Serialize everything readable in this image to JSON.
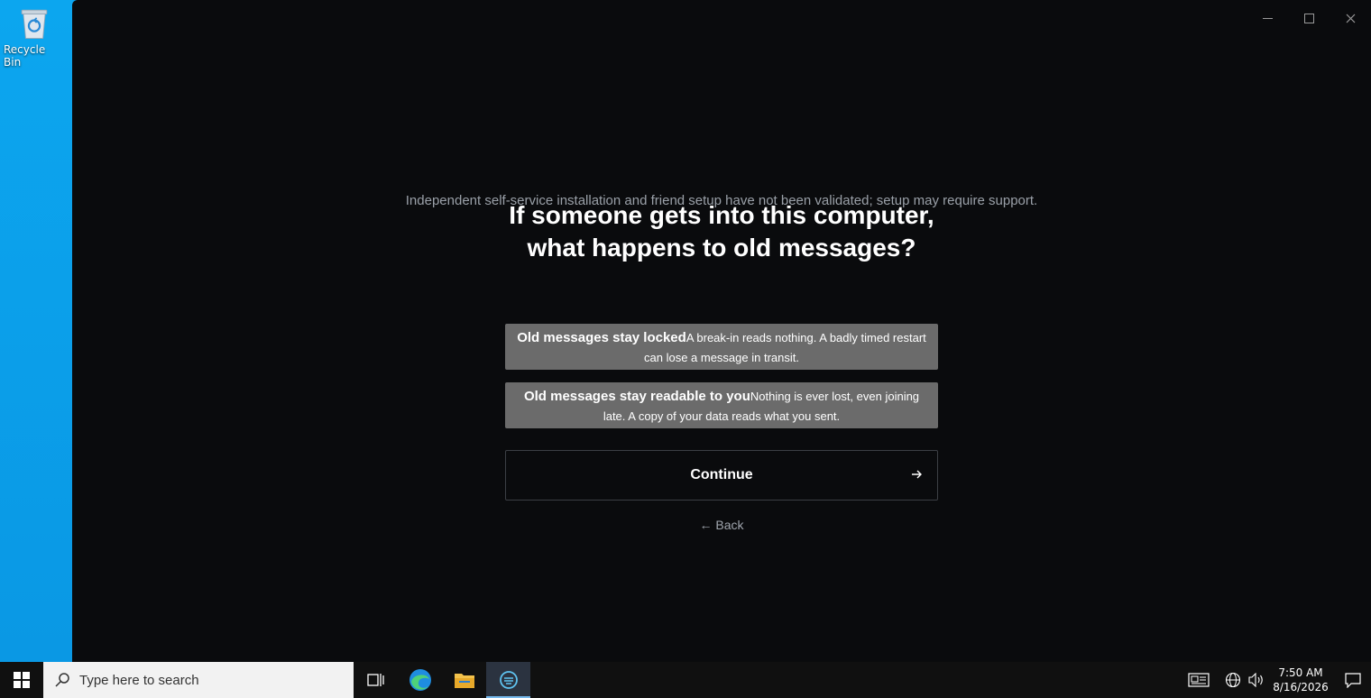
{
  "desktop": {
    "recycle_bin_label": "Recycle Bin"
  },
  "window": {
    "minimize_glyph": "—",
    "close_glyph": "✕"
  },
  "content": {
    "notice": "Independent self-service installation and friend setup have not been validated; setup may require support.",
    "title": "If someone gets into this computer, what happens to old messages?",
    "options": [
      {
        "title": "Old messages stay locked",
        "description": "A break-in reads nothing. A badly timed restart can lose a message in transit."
      },
      {
        "title": "Old messages stay readable to you",
        "description": "Nothing is ever lost, even joining late. A copy of your data reads what you sent."
      }
    ],
    "continue_label": "Continue",
    "back_label": "← Back"
  },
  "taskbar": {
    "search_placeholder": "Type here to search",
    "time": "7:50 AM",
    "date": "8/16/2026"
  },
  "colors": {
    "window_bg": "#0a0b0d",
    "option_bg": "#6b6b6b",
    "desktop_bg": "#0ca6ef",
    "taskbar_bg": "#101010"
  }
}
